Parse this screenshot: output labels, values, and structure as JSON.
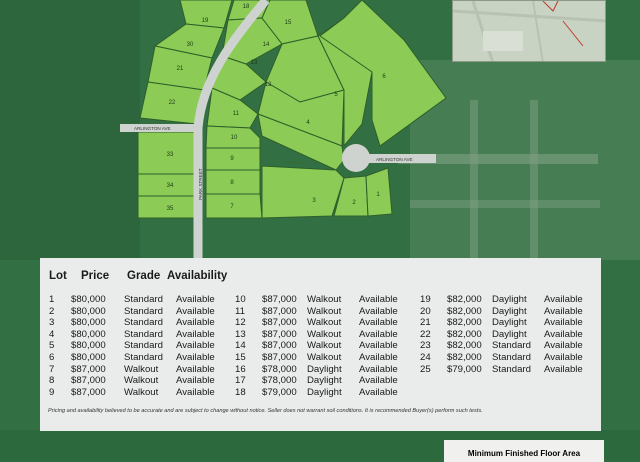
{
  "map": {
    "lot_labels": {
      "l19": "19",
      "l18": "18",
      "l15": "15",
      "l30": "30",
      "l14": "14",
      "l21": "21",
      "l13": "13",
      "l6": "6",
      "l22": "22",
      "l5": "5",
      "l11": "11",
      "l4": "4",
      "l10": "10",
      "l33": "33",
      "l9": "9",
      "l8": "8",
      "l34": "34",
      "l7": "7",
      "l35": "35",
      "l3": "3",
      "l2": "2",
      "l1": "1",
      "l12": "12"
    },
    "streets": {
      "arlington_west": "ARLINGTON AVE",
      "arlington_east": "ARLINGTON AVE",
      "park_street": "PARK STREET",
      "reserve": "RESERVE"
    }
  },
  "table": {
    "headers": {
      "lot": "Lot",
      "price": "Price",
      "grade": "Grade",
      "availability": "Availability"
    },
    "col1": [
      {
        "lot": "1",
        "price": "$80,000",
        "grade": "Standard",
        "availability": "Available"
      },
      {
        "lot": "2",
        "price": "$80,000",
        "grade": "Standard",
        "availability": "Available"
      },
      {
        "lot": "3",
        "price": "$80,000",
        "grade": "Standard",
        "availability": "Available"
      },
      {
        "lot": "4",
        "price": "$80,000",
        "grade": "Standard",
        "availability": "Available"
      },
      {
        "lot": "5",
        "price": "$80,000",
        "grade": "Standard",
        "availability": "Available"
      },
      {
        "lot": "6",
        "price": "$80,000",
        "grade": "Standard",
        "availability": "Available"
      },
      {
        "lot": "7",
        "price": "$87,000",
        "grade": "Walkout",
        "availability": "Available"
      },
      {
        "lot": "8",
        "price": "$87,000",
        "grade": "Walkout",
        "availability": "Available"
      },
      {
        "lot": "9",
        "price": "$87,000",
        "grade": "Walkout",
        "availability": "Available"
      }
    ],
    "col2": [
      {
        "lot": "10",
        "price": "$87,000",
        "grade": "Walkout",
        "availability": "Available"
      },
      {
        "lot": "11",
        "price": "$87,000",
        "grade": "Walkout",
        "availability": "Available"
      },
      {
        "lot": "12",
        "price": "$87,000",
        "grade": "Walkout",
        "availability": "Available"
      },
      {
        "lot": "13",
        "price": "$87,000",
        "grade": "Walkout",
        "availability": "Available"
      },
      {
        "lot": "14",
        "price": "$87,000",
        "grade": "Walkout",
        "availability": "Available"
      },
      {
        "lot": "15",
        "price": "$87,000",
        "grade": "Walkout",
        "availability": "Available"
      },
      {
        "lot": "16",
        "price": "$78,000",
        "grade": "Daylight",
        "availability": "Available"
      },
      {
        "lot": "17",
        "price": "$78,000",
        "grade": "Daylight",
        "availability": "Available"
      },
      {
        "lot": "18",
        "price": "$79,000",
        "grade": "Daylight",
        "availability": "Available"
      }
    ],
    "col3": [
      {
        "lot": "19",
        "price": "$82,000",
        "grade": "Daylight",
        "availability": "Available"
      },
      {
        "lot": "20",
        "price": "$82,000",
        "grade": "Daylight",
        "availability": "Available"
      },
      {
        "lot": "21",
        "price": "$82,000",
        "grade": "Daylight",
        "availability": "Available"
      },
      {
        "lot": "22",
        "price": "$82,000",
        "grade": "Daylight",
        "availability": "Available"
      },
      {
        "lot": "23",
        "price": "$82,000",
        "grade": "Standard",
        "availability": "Available"
      },
      {
        "lot": "24",
        "price": "$82,000",
        "grade": "Standard",
        "availability": "Available"
      },
      {
        "lot": "25",
        "price": "$79,000",
        "grade": "Standard",
        "availability": "Available"
      }
    ]
  },
  "disclaimer": "Pricing and availability believed to be accurate and are subject to change without notice. Seller does not warrant soil conditions. It is recommended Buyer(s) perform such tests.",
  "notice": "Minimum Finished Floor Area",
  "colors": {
    "lot_fill": "#8ccb55",
    "lot_stroke": "#2e5f2a",
    "background": "#2f6b3f",
    "road": "#cfd3cf",
    "panel": "#eaeceb"
  }
}
